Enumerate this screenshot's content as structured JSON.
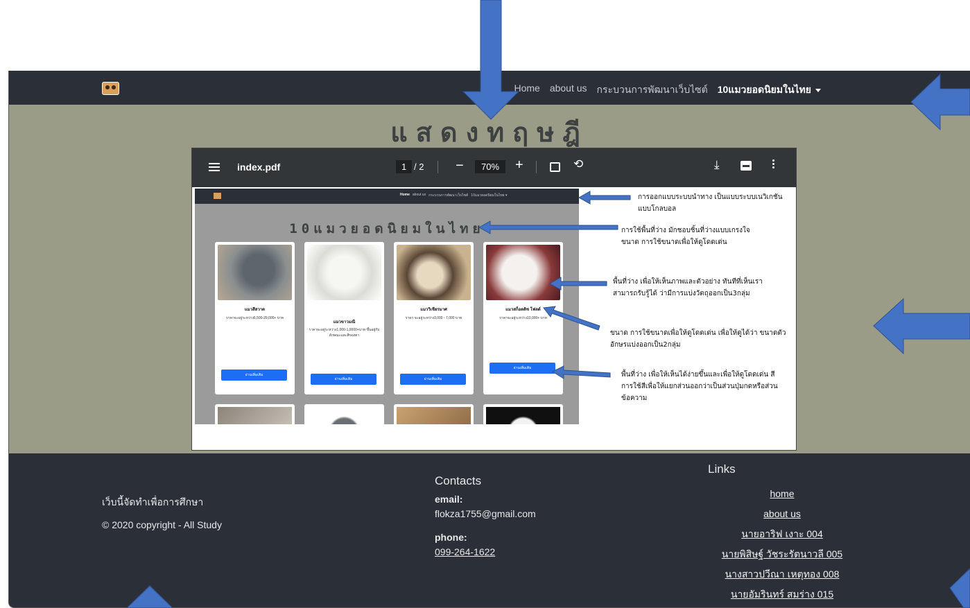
{
  "navbar": {
    "links": [
      "Home",
      "about us",
      "กระบวนการพัฒนาเว็บไซต์"
    ],
    "dropdown": "10แมวยอดนิยมในไทย"
  },
  "heading": "แสดงทฤษฎี",
  "pdf_viewer": {
    "filename": "index.pdf",
    "current_page": "1",
    "total_pages": "/ 2",
    "zoom": "70%",
    "document": {
      "nav_links": [
        "Home",
        "about us",
        "กระบวนการพัฒนาเว็บไซต์",
        "10แมวยอดนิยมในไทย ▾"
      ],
      "heading": "10แมวยอดนิยมในไทย",
      "cards": [
        {
          "title": "แมวสีสวาด",
          "price": "ราคาจะอยู่ระหว่าง6,500-29,000+ บาท",
          "button": "อ่านเพิ่มเติม",
          "color": "#6f7780"
        },
        {
          "title": "แมวขาวมณี",
          "price": "ราคาจะอยู่ระหว่าง1,000-1,0000+บาท ขึ้นอยู่กับลักษณะและสีของตา",
          "button": "อ่านเพิ่มเติม",
          "color": "#e9e9e6"
        },
        {
          "title": "แมววิเชียรมาศ",
          "price": "ราคา จะอยู่ระหว่าง3,000 - 7,000 บาท",
          "button": "อ่านเพิ่มเติม",
          "color": "#b79b78"
        },
        {
          "title": "แมวสก็อตติช โฟลด์",
          "price": "ราคาจะอยู่ระหว่าง10,000+ บาท",
          "button": "อ่านเพิ่มเติม",
          "color": "#d9d2cc"
        }
      ]
    },
    "notes": [
      "การออกแบบระบบนำทาง เป็นแบบระบบเนวิเกชันแบบโกลบอล",
      "การใช้พื้นที่ว่าง มักชอบชิ้นที่ว่างแบบเกรงใจ ขนาด การใช้ขนาดเพื่อให้ดูโดดเด่น",
      "พื้นที่ว่าง เพื่อให้เห็นภาพและตัวอย่าง ทันทีที่เห็นเราสามารถรับรู้ได้ ว่ามีการแบ่งวัตถุออกเป็น3กลุ่ม",
      "ขนาด การใช้ขนาดเพื่อให้ดูโดดเด่น เพื่อให้ดูได้ว่า ขนาดตัวอักษรแบ่งออกเป็น2กลุ่ม",
      "พื้นที่ว่าง เพื่อให้เห็นได้ง่ายขึ้นและเพื่อให้ดูโดดเด่น สี การใช้สีเพื่อให้แยกส่วนออกว่าเป็นส่วนปุ่มกดหรือส่วนข้อความ"
    ]
  },
  "footer": {
    "purpose": "เว็บนี้จัดทำเพื่อการศึกษา",
    "copyright": "© 2020 copyright - All Study",
    "contacts_title": "Contacts",
    "email_label": "email:",
    "email": "flokza1755@gmail.com",
    "phone_label": "phone:",
    "phone": "099-264-1622",
    "links_title": "Links",
    "links": [
      "home",
      "about us",
      "นายอาริฟ เงาะ 004",
      "นายพิสิษฐ์ วัชระรัตนาวลี 005",
      "นางสาวปวีณา เหตุทอง 008",
      "นายอัมรินทร์ สมร่าง 015"
    ]
  },
  "colors": {
    "navbar": "#2a2f38",
    "page_bg": "#9a9c87",
    "arrow": "#4472c4",
    "button": "#1d6ef5"
  }
}
